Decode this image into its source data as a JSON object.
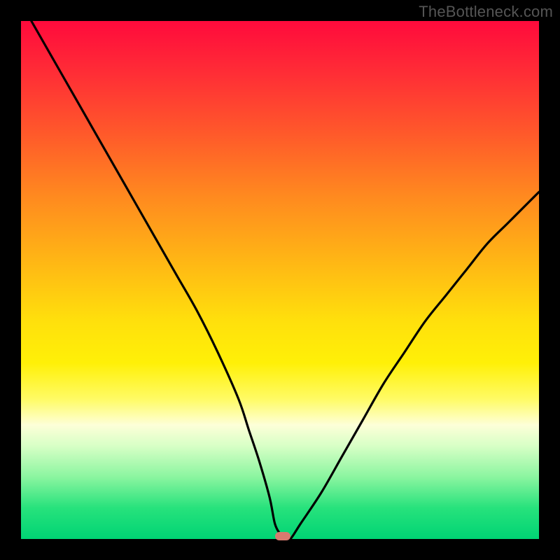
{
  "attribution": "TheBottleneck.com",
  "chart_data": {
    "type": "line",
    "title": "",
    "xlabel": "",
    "ylabel": "",
    "xlim": [
      0,
      100
    ],
    "ylim": [
      0,
      100
    ],
    "series": [
      {
        "name": "bottleneck-curve",
        "x": [
          2,
          6,
          10,
          14,
          18,
          22,
          26,
          30,
          34,
          38,
          42,
          44,
          46,
          48,
          49,
          50,
          51,
          52,
          54,
          58,
          62,
          66,
          70,
          74,
          78,
          82,
          86,
          90,
          94,
          98,
          100
        ],
        "values": [
          100,
          93,
          86,
          79,
          72,
          65,
          58,
          51,
          44,
          36,
          27,
          21,
          15,
          8,
          3,
          1,
          0,
          0,
          3,
          9,
          16,
          23,
          30,
          36,
          42,
          47,
          52,
          57,
          61,
          65,
          67
        ]
      }
    ],
    "annotations": [
      {
        "name": "optimum-marker",
        "x": 50.5,
        "y": 0.5
      }
    ],
    "gradient_bands": [
      {
        "color": "#ff0a3c",
        "stop": 0
      },
      {
        "color": "#ffe00c",
        "stop": 58
      },
      {
        "color": "#00d474",
        "stop": 100
      }
    ]
  }
}
